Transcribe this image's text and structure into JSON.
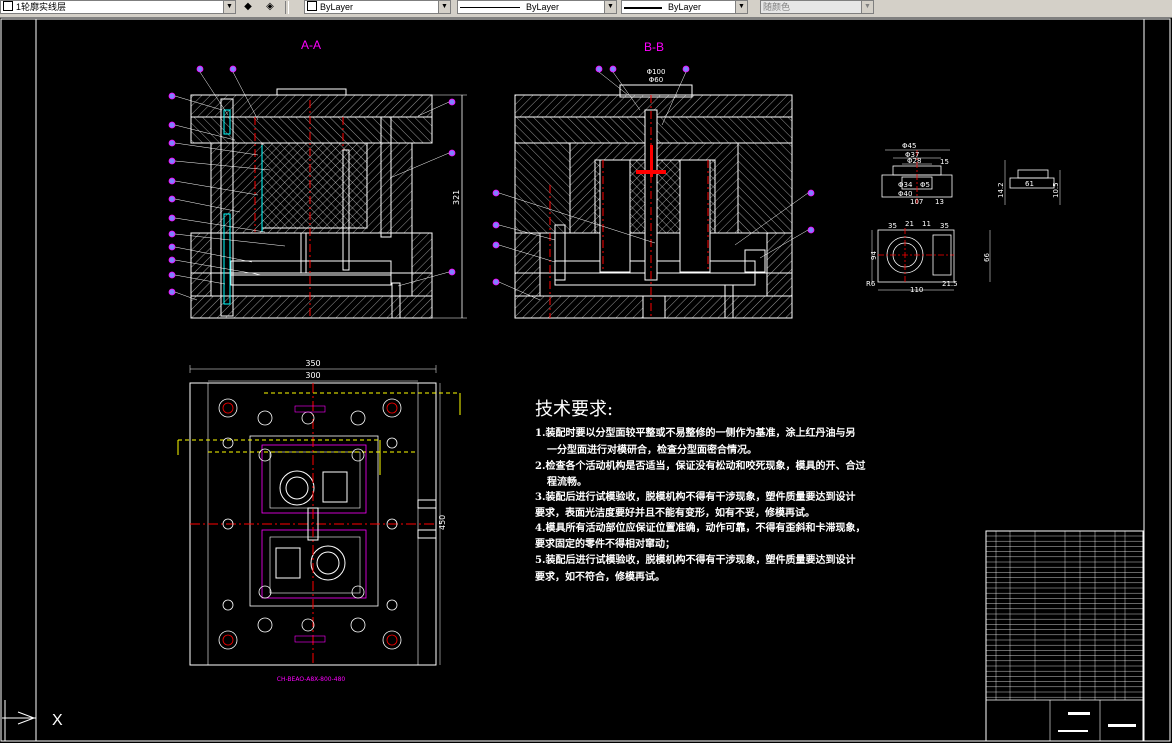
{
  "toolbar": {
    "layer_combo": "1轮廓实线层",
    "color_combo": "ByLayer",
    "linetype_combo": "ByLayer",
    "lineweight_combo": "ByLayer",
    "plotstyle_combo": "随颜色"
  },
  "drawing": {
    "section_a": "A-A",
    "section_b": "B-B",
    "dims": {
      "height_321": "321",
      "w_350": "350",
      "w_300": "300",
      "h_450": "450",
      "b_phi100": "Φ100",
      "b_phi60": "Φ60",
      "p_45": "Φ45",
      "p_37": "Φ37",
      "p_28": "Φ28",
      "p_34": "Φ34",
      "p_5": "Φ5",
      "p_40": "Φ40",
      "p_107": "107",
      "p_13": "13",
      "p_15": "15",
      "p_61": "61",
      "p_142": "14.2",
      "p_105": "10.5",
      "t_35": "35",
      "t_21": "21",
      "t_11": "11",
      "t_110": "110",
      "t_215": "21.5",
      "t_94": "94",
      "t_r60": "R6",
      "t_66": "66"
    },
    "bottom_label": "CH-BEAO-A8X-800-480"
  },
  "tech_requirements": {
    "title": "技术要求:",
    "lines": [
      "1.装配时要以分型面较平整或不易整修的一侧作为基准，涂上红丹油与另",
      "一分型面进行对模研合，检查分型面密合情况。",
      "2.检查各个活动机构是否适当，保证没有松动和咬死现象，模具的开、合过",
      "程流畅。",
      "3.装配后进行试模验收，脱模机构不得有干涉现象，塑件质量要达到设计",
      "要求，表面光洁度要好并且不能有变形，如有不妥，修模再试。",
      "4.模具所有活动部位应保证位置准确，动作可靠，不得有歪斜和卡滞现象，",
      "要求固定的零件不得相对窜动；",
      "5.装配后进行试模验收，脱模机构不得有干涉现象，塑件质量要达到设计",
      "要求，如不符合，修模再试。"
    ]
  },
  "ucs": {
    "x_label": "X"
  }
}
